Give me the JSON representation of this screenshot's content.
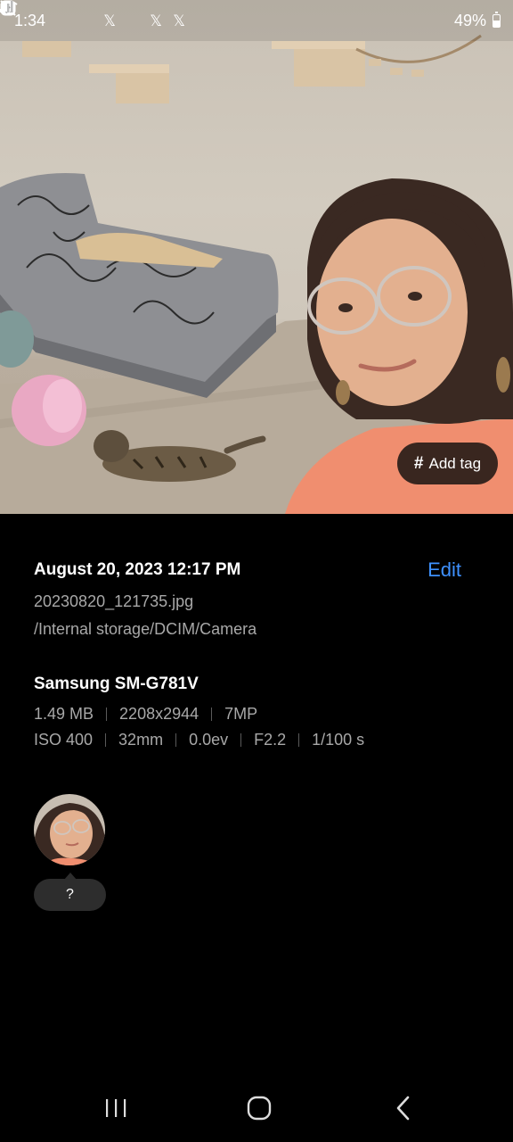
{
  "status_bar": {
    "time": "1:34",
    "left_icons": [
      "discord-icon",
      "account-icon",
      "x-icon",
      "instagram-icon",
      "x-icon",
      "x-icon",
      "dot-icon"
    ],
    "right_icons": [
      "alarm-icon",
      "mute-icon",
      "wifi-icon",
      "signal-icon"
    ],
    "battery_percent": "49%",
    "battery_level": 0.49
  },
  "photo": {
    "add_tag_label": "Add tag"
  },
  "details": {
    "date": "August 20, 2023 12:17 PM",
    "edit_label": "Edit",
    "file_name": "20230820_121735.jpg",
    "file_path": "/Internal storage/DCIM/Camera"
  },
  "device": {
    "name": "Samsung SM-G781V",
    "specs_row1": [
      "1.49 MB",
      "2208x2944",
      "7MP"
    ],
    "specs_row2": [
      "ISO 400",
      "32mm",
      "0.0ev",
      "F2.2",
      "1/100 s"
    ]
  },
  "faces": [
    {
      "label": "?"
    }
  ],
  "colors": {
    "accent": "#3e91ff",
    "secondary_text": "#a8a8a8",
    "background": "#000000"
  }
}
